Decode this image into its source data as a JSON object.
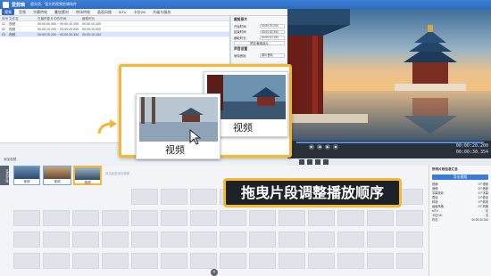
{
  "window": {
    "app_name": "爱剪辑",
    "subtitle": "超实用、强大的视频剪辑软件"
  },
  "menu": [
    {
      "label": "视频",
      "active": true
    },
    {
      "label": "音频",
      "active": false
    },
    {
      "label": "字幕特效",
      "active": false
    },
    {
      "label": "叠加素材",
      "active": false
    },
    {
      "label": "转场特效",
      "active": false
    },
    {
      "label": "画面风格",
      "active": false
    },
    {
      "label": "MTV",
      "active": false
    },
    {
      "label": "卡拉OK",
      "active": false
    },
    {
      "label": "升级与服务",
      "active": false
    }
  ],
  "list": {
    "headers": [
      "序号",
      "文件名",
      "在最终影片中的时间",
      "截取时长"
    ],
    "rows": [
      {
        "num": "01",
        "name": "视频",
        "time": "00:00:00.000 ~ 00:00:10.200",
        "dur": "00:00:10.200"
      },
      {
        "num": "02",
        "name": "视频",
        "time": "00:00:10.200 ~ 00:00:20.200",
        "dur": "00:00:10.000"
      },
      {
        "num": "03",
        "name": "视频",
        "time": "00:00:20.200 ~ 00:00:30.354",
        "dur": "00:00:10.154"
      }
    ]
  },
  "props": {
    "title": "裁剪原片",
    "start_label": "开始时间:",
    "start_val": "00:00:20.200",
    "end_label": "结束时间:",
    "end_val": "00:00:30.354",
    "dur_label": "截取时长:",
    "dur_val": "00:00:10.154",
    "preview_btn": "预览/截取原片",
    "sound_title": "声音设置",
    "sound_label": "使用音轨:",
    "sound_val": "原片音轨"
  },
  "player": {
    "time_current": "00:00:20.200",
    "time_total": "00:00:30.354"
  },
  "timeline": {
    "add_label": "添加视频",
    "tab_label": "已添加片段",
    "clips": [
      {
        "label": "视频"
      },
      {
        "label": "视频"
      },
      {
        "label": "视频"
      }
    ],
    "placeholder": "双击此处添加视频"
  },
  "rightpanel": {
    "title": "所有片段信息汇总",
    "export_btn": "导出视频",
    "rows": [
      {
        "k": "视频:",
        "v": "3个视频"
      },
      {
        "k": "音频:",
        "v": "0个音频"
      },
      {
        "k": "字幕特效:",
        "v": "0个字幕"
      },
      {
        "k": "叠加:",
        "v": "0个叠加"
      },
      {
        "k": "转场:",
        "v": "0个转场"
      },
      {
        "k": "画面风格:",
        "v": "0个风格"
      },
      {
        "k": "MTV:",
        "v": "无"
      },
      {
        "k": "卡拉OK:",
        "v": "无"
      },
      {
        "k": "时长:",
        "v": "00:00:30.354"
      }
    ]
  },
  "popup": {
    "card_front": "视频",
    "card_back": "视频"
  },
  "banner": "拖曳片段调整播放顺序"
}
